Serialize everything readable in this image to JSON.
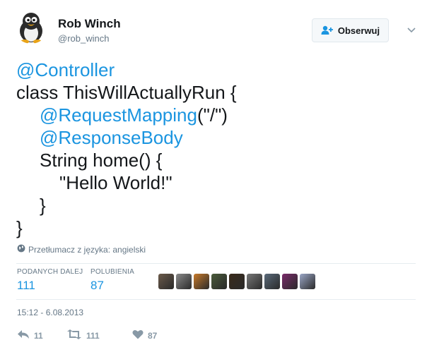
{
  "author": {
    "name": "Rob Winch",
    "handle": "@rob_winch",
    "avatar_icon": "penguin-avatar-icon"
  },
  "follow_button": {
    "label": "Obserwuj",
    "icon": "follow-person-plus-icon"
  },
  "more_menu": {
    "icon": "chevron-down-icon"
  },
  "tweet_lines": [
    {
      "parts": [
        {
          "t": "@Controller",
          "link": true
        }
      ],
      "indent": 0
    },
    {
      "parts": [
        {
          "t": "class ThisWillActuallyRun {",
          "link": false
        }
      ],
      "indent": 0
    },
    {
      "parts": [
        {
          "t": "@RequestMapping",
          "link": true
        },
        {
          "t": "(\"/\")",
          "link": false
        }
      ],
      "indent": 1
    },
    {
      "parts": [
        {
          "t": "@ResponseBody",
          "link": true
        }
      ],
      "indent": 1
    },
    {
      "parts": [
        {
          "t": "String home() {",
          "link": false
        }
      ],
      "indent": 1
    },
    {
      "parts": [
        {
          "t": "\"Hello World!\"",
          "link": false
        }
      ],
      "indent": 2
    },
    {
      "parts": [
        {
          "t": "}",
          "link": false
        }
      ],
      "indent": 1
    },
    {
      "parts": [
        {
          "t": "}",
          "link": false
        }
      ],
      "indent": 0
    }
  ],
  "translate": {
    "label": "Przetłumacz z języka: angielski",
    "icon": "globe-icon"
  },
  "stats": {
    "retweets": {
      "label": "PODANYCH DALEJ",
      "value": "111"
    },
    "likes": {
      "label": "POLUBIENIA",
      "value": "87"
    }
  },
  "liker_avatars": [
    "#6b5a4a",
    "#8a8a8a",
    "#c87a2a",
    "#4a5a3a",
    "#3a2a1a",
    "#777777",
    "#5a6a7a",
    "#7a2a6a",
    "#9aa6c6"
  ],
  "timestamp": "15:12 - 6.08.2013",
  "actions": {
    "reply": {
      "count": "11",
      "icon": "reply-icon"
    },
    "retweet": {
      "count": "111",
      "icon": "retweet-icon"
    },
    "like": {
      "count": "87",
      "icon": "heart-icon"
    }
  },
  "colors": {
    "link": "#1b95e0",
    "muted": "#657786",
    "action": "#8899a6"
  }
}
